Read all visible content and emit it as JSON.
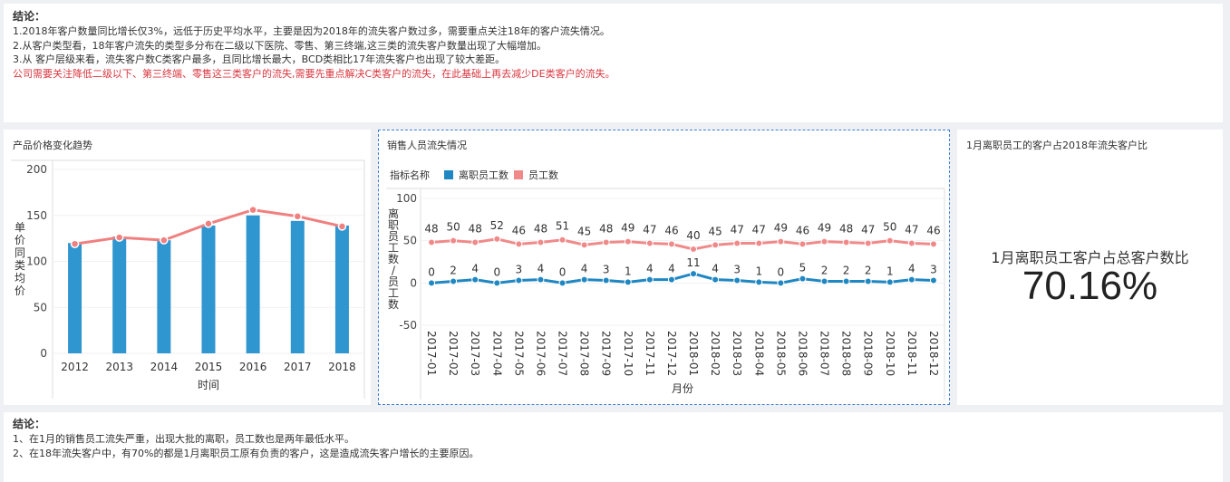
{
  "top_conclusion": {
    "title": "结论：",
    "lines": [
      "1.2018年客户数量同比增长仅3%，远低于历史平均水平，主要是因为2018年的流失客户数过多，需要重点关注18年的客户流失情况。",
      "2.从客户类型看，18年客户流失的类型多分布在二级以下医院、零售、第三终端,这三类的流失客户数量出现了大幅增加。",
      "3.从 客户层级来看，流失客户数C类客户最多，且同比增长最大，BCD类相比17年流失客户也出现了较大差距。"
    ],
    "highlight": "公司需要关注降低二级以下、第三终端、零售这三类客户的流失,需要先重点解决C类客户的流失，在此基础上再去减少DE类客户的流失。",
    "highlight_color": "#d9363e"
  },
  "chart1": {
    "title": "产品价格变化趋势",
    "chart_data": {
      "type": "bar",
      "categories": [
        "2012",
        "2013",
        "2014",
        "2015",
        "2016",
        "2017",
        "2018"
      ],
      "series": [
        {
          "type": "bar",
          "values": [
            120,
            127,
            123,
            139,
            150,
            144,
            139
          ],
          "color": "#2f96d0"
        },
        {
          "type": "line",
          "values": [
            119,
            126,
            123,
            141,
            156,
            149,
            138
          ],
          "color": "#f08080"
        }
      ],
      "xlabel": "时间",
      "ylabel": "单价同类均价",
      "ylim": [
        0,
        200
      ],
      "yticks": [
        0,
        50,
        100,
        150,
        200
      ]
    }
  },
  "chart2": {
    "title": "销售人员流失情况",
    "legend_title": "指标名称",
    "chart_data": {
      "type": "line",
      "categories": [
        "2017-01",
        "2017-02",
        "2017-03",
        "2017-04",
        "2017-05",
        "2017-06",
        "2017-07",
        "2017-08",
        "2017-09",
        "2017-10",
        "2017-11",
        "2017-12",
        "2018-01",
        "2018-02",
        "2018-03",
        "2018-04",
        "2018-05",
        "2018-06",
        "2018-07",
        "2018-08",
        "2018-09",
        "2018-10",
        "2018-11",
        "2018-12"
      ],
      "series": [
        {
          "name": "离职员工数",
          "values": [
            0,
            2,
            4,
            0,
            3,
            4,
            0,
            4,
            3,
            1,
            4,
            4,
            11,
            4,
            3,
            1,
            0,
            5,
            2,
            2,
            2,
            1,
            4,
            3
          ],
          "color": "#1f87c2"
        },
        {
          "name": "员工数",
          "values": [
            48,
            50,
            48,
            52,
            46,
            48,
            51,
            45,
            48,
            49,
            47,
            46,
            40,
            45,
            47,
            47,
            49,
            46,
            49,
            48,
            47,
            50,
            47,
            46
          ],
          "color": "#f08a8a"
        }
      ],
      "xlabel": "月份",
      "ylabel": "离职员工数/员工数",
      "ylim": [
        -50,
        100
      ],
      "yticks": [
        -50,
        0,
        50,
        100
      ]
    }
  },
  "kpi": {
    "title": "1月离职员工的客户占2018年流失客户比",
    "label": "1月离职员工客户占总客户数比",
    "value": "70.16%"
  },
  "bottom_conclusion": {
    "title": "结论：",
    "lines": [
      "1、在1月的销售员工流失严重，出现大批的离职，员工数也是两年最低水平。",
      "2、在18年流失客户中，有70%的都是1月离职员工原有负责的客户，这是造成流失客户增长的主要原因。"
    ]
  }
}
